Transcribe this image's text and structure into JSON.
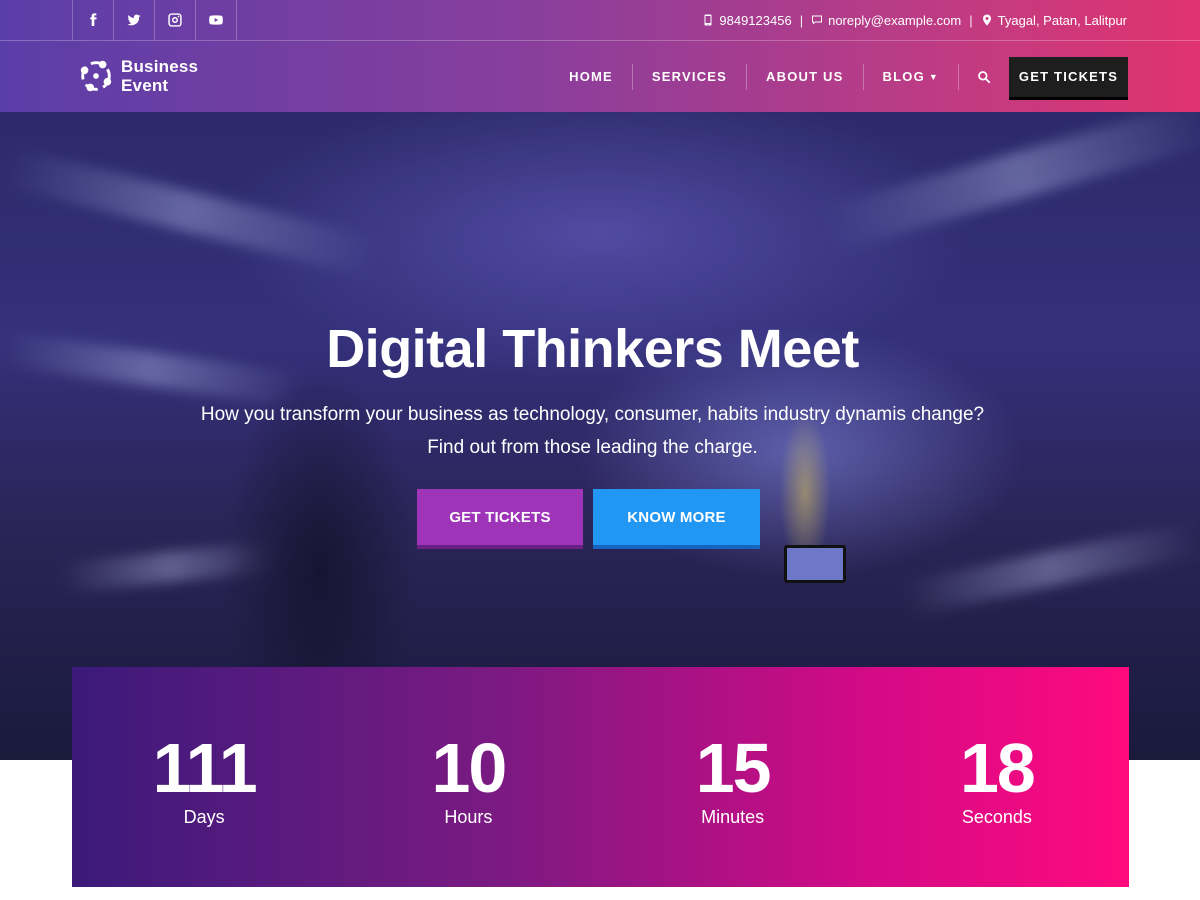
{
  "header": {
    "socials": [
      {
        "icon": "facebook-icon"
      },
      {
        "icon": "twitter-icon"
      },
      {
        "icon": "instagram-icon"
      },
      {
        "icon": "youtube-icon"
      }
    ],
    "contact": {
      "phone": "9849123456",
      "email": "noreply@example.com",
      "address": "Tyagal, Patan, Lalitpur",
      "separator": "|"
    },
    "logo": {
      "line1": "Business",
      "line2": "Event"
    },
    "nav": {
      "home": "HOME",
      "services": "SERVICES",
      "about": "ABOUT US",
      "blog": "BLOG",
      "cta": "GET TICKETS"
    }
  },
  "hero": {
    "title": "Digital Thinkers Meet",
    "subtitle_line1": "How you transform your business as technology, consumer, habits industry dynamis change?",
    "subtitle_line2": "Find out from those leading the charge.",
    "btn_primary": "GET TICKETS",
    "btn_secondary": "KNOW MORE"
  },
  "countdown": {
    "items": [
      {
        "value": "111",
        "label": "Days"
      },
      {
        "value": "10",
        "label": "Hours"
      },
      {
        "value": "15",
        "label": "Minutes"
      },
      {
        "value": "18",
        "label": "Seconds"
      }
    ]
  },
  "colors": {
    "accent_purple": "#9e35b8",
    "accent_blue": "#2196f3",
    "accent_pink": "#ff0a7e"
  }
}
